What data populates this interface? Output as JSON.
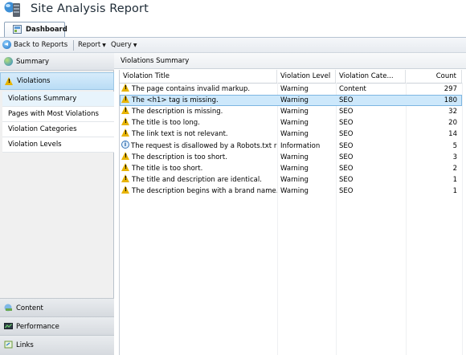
{
  "app": {
    "title": "Site Analysis Report",
    "icon": "server-icon"
  },
  "tabs": [
    {
      "label": "Dashboard",
      "icon": "dashboard-icon",
      "active": true
    }
  ],
  "toolbar": {
    "back_label": "Back to Reports",
    "report_label": "Report",
    "query_label": "Query"
  },
  "sidebar": {
    "summary": "Summary",
    "violations": "Violations",
    "sub_items": [
      {
        "label": "Violations Summary",
        "active": true
      },
      {
        "label": "Pages with Most Violations"
      },
      {
        "label": "Violation Categories"
      },
      {
        "label": "Violation Levels"
      }
    ],
    "bottom": [
      {
        "label": "Content",
        "icon": "content-icon"
      },
      {
        "label": "Performance",
        "icon": "performance-icon"
      },
      {
        "label": "Links",
        "icon": "links-icon"
      }
    ]
  },
  "main": {
    "title": "Violations Summary",
    "columns": {
      "title": "Violation Title",
      "level": "Violation Level",
      "category": "Violation Cate...",
      "count": "Count"
    },
    "rows": [
      {
        "icon": "warning",
        "title": "The page contains invalid markup.",
        "level": "Warning",
        "category": "Content",
        "count": "297"
      },
      {
        "icon": "warning",
        "title": "The <h1> tag is missing.",
        "level": "Warning",
        "category": "SEO",
        "count": "180",
        "selected": true
      },
      {
        "icon": "warning",
        "title": "The description is missing.",
        "level": "Warning",
        "category": "SEO",
        "count": "32"
      },
      {
        "icon": "warning",
        "title": "The title is too long.",
        "level": "Warning",
        "category": "SEO",
        "count": "20"
      },
      {
        "icon": "warning",
        "title": "The link text is not relevant.",
        "level": "Warning",
        "category": "SEO",
        "count": "14"
      },
      {
        "icon": "info",
        "title": "The request is disallowed by a Robots.txt rule.",
        "level": "Information",
        "category": "SEO",
        "count": "5"
      },
      {
        "icon": "warning",
        "title": "The description is too short.",
        "level": "Warning",
        "category": "SEO",
        "count": "3"
      },
      {
        "icon": "warning",
        "title": "The title is too short.",
        "level": "Warning",
        "category": "SEO",
        "count": "2"
      },
      {
        "icon": "warning",
        "title": "The title and description are identical.",
        "level": "Warning",
        "category": "SEO",
        "count": "1"
      },
      {
        "icon": "warning",
        "title": "The description begins with a brand name.",
        "level": "Warning",
        "category": "SEO",
        "count": "1"
      }
    ]
  }
}
